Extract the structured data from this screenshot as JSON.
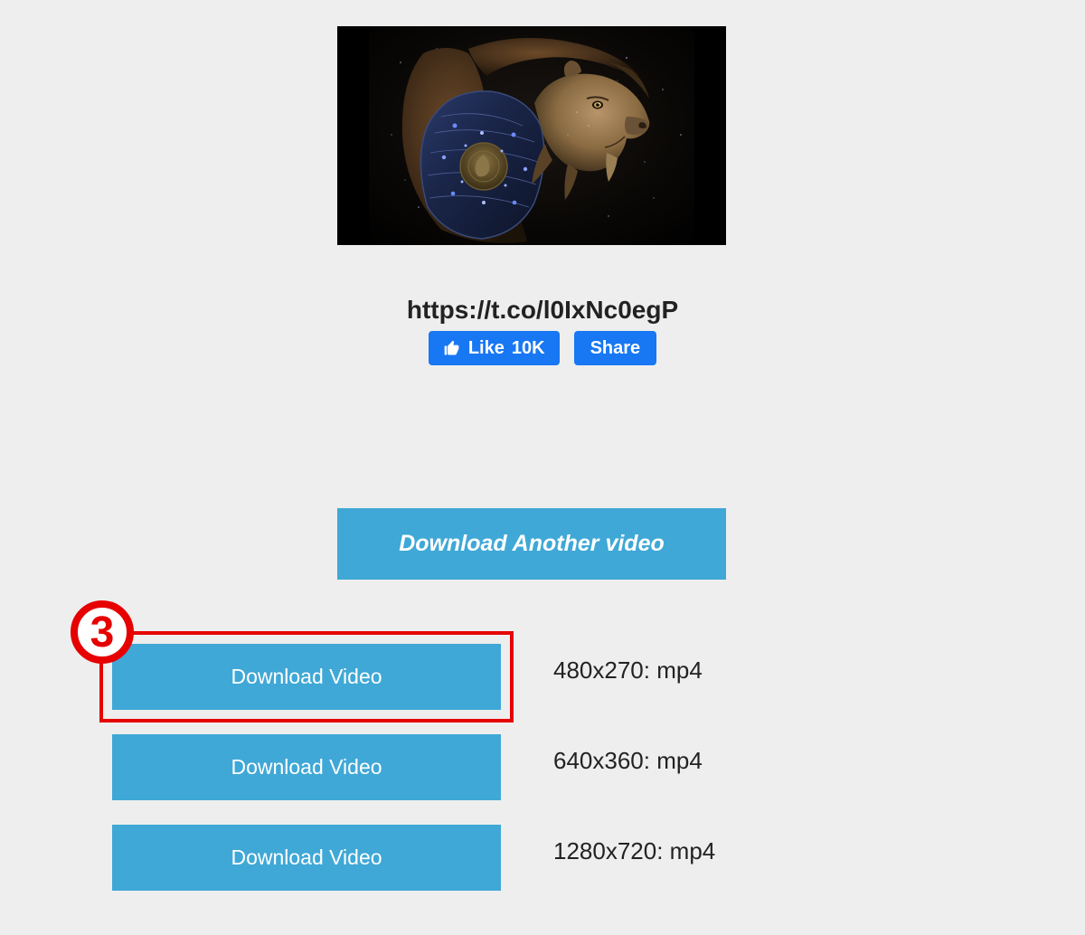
{
  "thumbnail_alt": "lion-video-thumbnail",
  "video_url": "https://t.co/l0IxNc0egP",
  "social": {
    "like_label": "Like",
    "like_count": "10K",
    "share_label": "Share"
  },
  "download_another_label": "Download Another video",
  "step_badge": "3",
  "formats": [
    {
      "button_label": "Download Video",
      "resolution_label": "480x270: mp4"
    },
    {
      "button_label": "Download Video",
      "resolution_label": "640x360: mp4"
    },
    {
      "button_label": "Download Video",
      "resolution_label": "1280x720: mp4"
    }
  ]
}
